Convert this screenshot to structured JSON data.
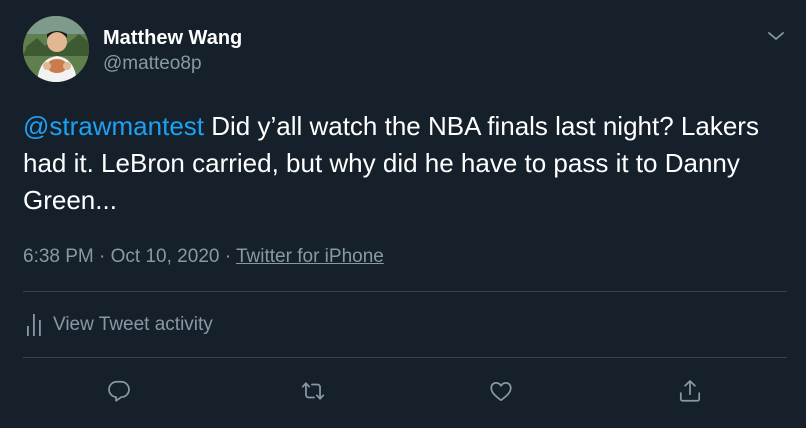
{
  "author": {
    "display_name": "Matthew Wang",
    "handle": "@matteo8p"
  },
  "tweet": {
    "mention": "@strawmantest",
    "text": " Did y’all watch the NBA finals last night? Lakers had it. LeBron carried, but why did he have to pass it to Danny Green...",
    "time": "6:38 PM",
    "separator": "·",
    "date": "Oct 10, 2020",
    "source": "Twitter for iPhone"
  },
  "activity_label": "View Tweet activity",
  "icons": {
    "caret": "chevron-down-icon",
    "activity": "bar-chart-icon",
    "reply": "reply-icon",
    "retweet": "retweet-icon",
    "like": "heart-icon",
    "share": "share-icon"
  },
  "colors": {
    "background": "#15202b",
    "text": "#ffffff",
    "secondary": "#8899a6",
    "accent": "#1da1f2",
    "divider": "#38444d"
  }
}
